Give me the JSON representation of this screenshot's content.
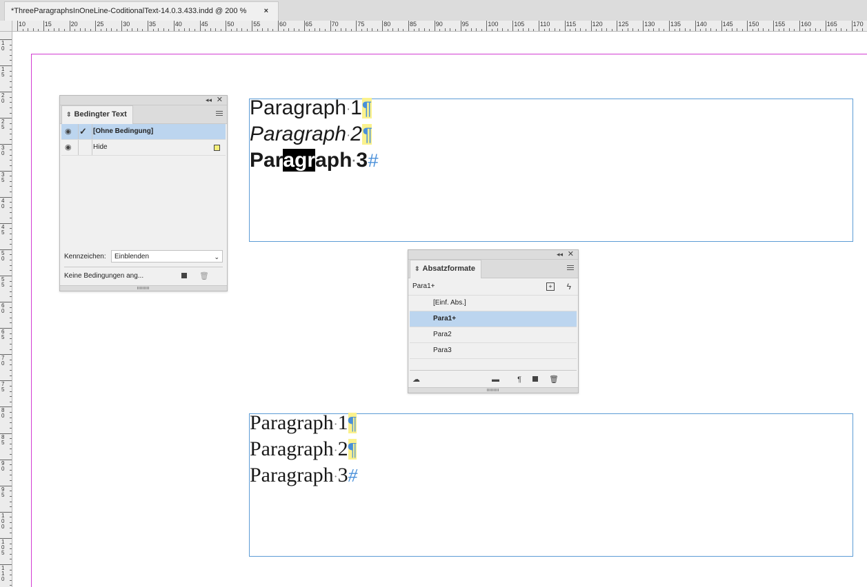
{
  "document": {
    "tab_title": "*ThreeParagraphsInOneLine-CoditionalText-14.0.3.433.indd @ 200 %",
    "close_label": "×"
  },
  "ruler": {
    "h_labels": [
      "10",
      "15",
      "20",
      "25",
      "30",
      "35",
      "40",
      "45",
      "50",
      "55",
      "60",
      "65",
      "70",
      "75",
      "80",
      "85",
      "90",
      "95",
      "100",
      "105",
      "110",
      "115",
      "120",
      "125",
      "130",
      "135",
      "140",
      "145",
      "150",
      "155",
      "160",
      "165",
      "170"
    ],
    "v_labels": [
      "10",
      "15",
      "20",
      "25",
      "30",
      "35",
      "40",
      "45",
      "50",
      "55",
      "60",
      "65",
      "70",
      "75",
      "80",
      "85",
      "90",
      "95",
      "100",
      "105",
      "110"
    ]
  },
  "frame1": {
    "line1": {
      "word": "Paragraph",
      "num": "1",
      "mark": "¶"
    },
    "line2": {
      "word": "Paragraph",
      "num": "2",
      "mark": "¶"
    },
    "line3": {
      "pre": "Par",
      "selected": "agr",
      "post": "aph",
      "num": "3",
      "mark": "#"
    }
  },
  "frame2": {
    "line1": {
      "word": "Paragraph",
      "num": "1",
      "mark": "¶"
    },
    "line2": {
      "word": "Paragraph",
      "num": "2",
      "mark": "¶"
    },
    "line3": {
      "word": "Paragraph",
      "num": "3",
      "mark": "#"
    }
  },
  "conditional_panel": {
    "tab_label": "Bedingter Text",
    "rows": [
      {
        "label": "[Ohne Bedingung]",
        "visible": true,
        "checked": true,
        "selected": true
      },
      {
        "label": "Hide",
        "visible": true,
        "checked": false,
        "selected": false,
        "swatch_color": "#f5f07a"
      }
    ],
    "indicator_label": "Kennzeichen:",
    "indicator_value": "Einblenden",
    "status_text": "Keine Bedingungen ang..."
  },
  "para_panel": {
    "tab_label": "Absatzformate",
    "current_style": "Para1+",
    "items": [
      {
        "label": "[Einf. Abs.]",
        "selected": false
      },
      {
        "label": "Para1+",
        "selected": true
      },
      {
        "label": "Para2",
        "selected": false
      },
      {
        "label": "Para3",
        "selected": false
      }
    ]
  },
  "colors": {
    "page_edge": "#d23ad2",
    "frame_border": "#5b9bd5",
    "condition_highlight": "#fbf28d",
    "selection_row": "#bcd5ef"
  }
}
